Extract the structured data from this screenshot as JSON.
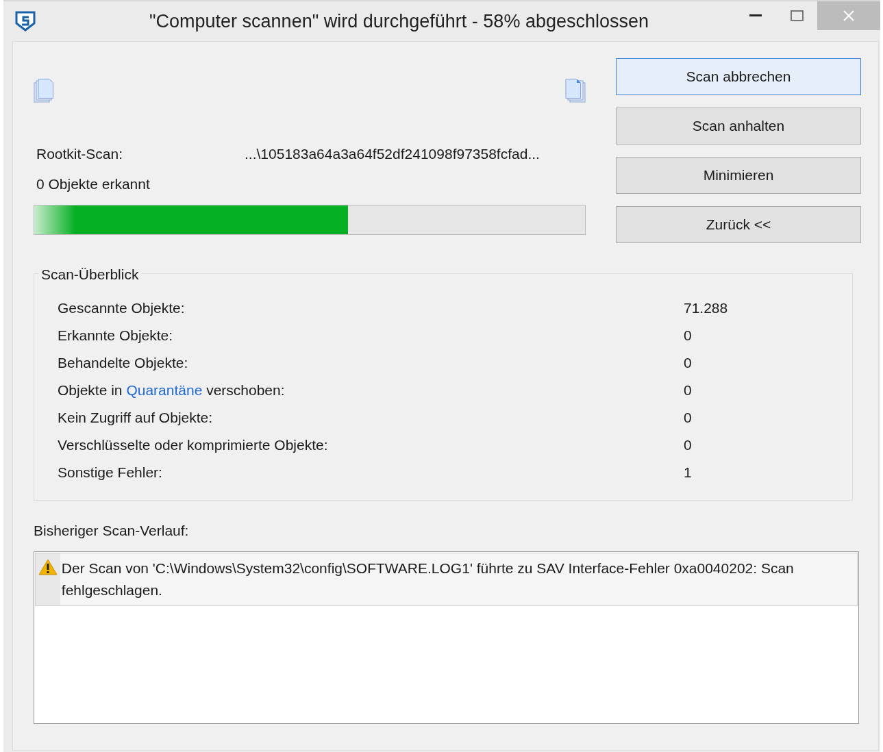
{
  "window": {
    "title": "\"Computer scannen\" wird durchgeführt - 58% abgeschlossen"
  },
  "scan": {
    "current_label": "Rootkit-Scan:",
    "current_path": "...\\105183a64a3a64f52df241098f97358fcfad...",
    "detected": "0 Objekte erkannt",
    "progress": {
      "level": 0.57
    }
  },
  "buttons": [
    {
      "label": "Scan abbrechen",
      "default": true
    },
    {
      "label": "Scan anhalten",
      "default": false
    },
    {
      "label": "Minimieren",
      "default": false
    },
    {
      "label": "Zurück <<",
      "default": false
    }
  ],
  "overview": {
    "title": "Scan-Überblick",
    "rows": [
      {
        "label": "Gescannte Objekte:",
        "value": "71.288"
      },
      {
        "label": "Erkannte Objekte:",
        "value": "0"
      },
      {
        "label": "Behandelte Objekte:",
        "value": "0"
      },
      {
        "label": "Objekte in",
        "link": "Quarantäne",
        "label_after": "verschoben:",
        "value": "0"
      },
      {
        "label": "Kein Zugriff auf Objekte:",
        "value": "0"
      },
      {
        "label": "Verschlüsselte oder komprimierte Objekte:",
        "value": "0"
      },
      {
        "label": "Sonstige Fehler:",
        "value": "1"
      }
    ]
  },
  "history": {
    "title": "Bisheriger Scan-Verlauf:",
    "entries": [
      {
        "kind": "warning",
        "text": "Der Scan von 'C:\\Windows\\System32\\config\\SOFTWARE.LOG1' führte zu SAV Interface-Fehler 0xa0040202: Scan fehlgeschlagen."
      }
    ]
  }
}
